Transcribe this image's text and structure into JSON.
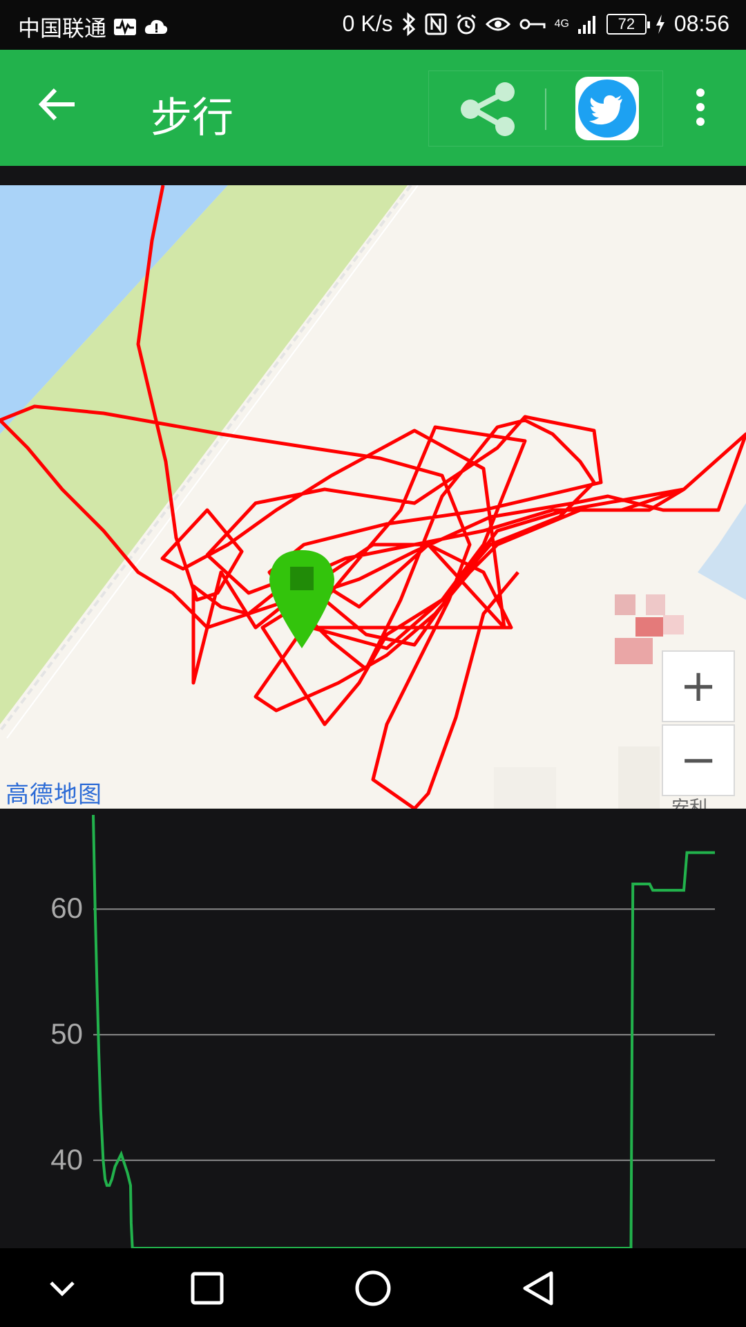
{
  "status_bar": {
    "carrier": "中国联通",
    "network_speed": "0 K/s",
    "network_type": "4G",
    "battery_level": "72",
    "time": "08:56",
    "icons": [
      "pulse-icon",
      "cloud-alert-icon",
      "bluetooth-icon",
      "nfc-icon",
      "alarm-icon",
      "eye-icon",
      "key-icon",
      "signal-icon",
      "charging-icon"
    ]
  },
  "app_bar": {
    "title": "步行",
    "icons": [
      "back-arrow-icon",
      "share-icon",
      "twitter-icon",
      "more-vert-icon"
    ],
    "color": "#22b24c"
  },
  "map": {
    "provider_logo": "高德地图",
    "zoom_in_label": "+",
    "zoom_out_label": "−",
    "poi_label_partial": "安利",
    "track_color": "#ff0000",
    "marker_color": "#33c40c"
  },
  "chart_data": {
    "type": "line",
    "title": "",
    "xlabel": "",
    "ylabel": "",
    "ylim": [
      33,
      68
    ],
    "xlim": [
      0,
      100
    ],
    "yticks": [
      60,
      50,
      40
    ],
    "grid": true,
    "line_color": "#22b24c",
    "series": [
      {
        "x": [
          0,
          0.3,
          0.6,
          0.9,
          1.2,
          1.6,
          1.9,
          2.2,
          2.6,
          3.0,
          3.5,
          4.5,
          5.5,
          6.0,
          6.1,
          6.3,
          86.5,
          86.8,
          89.5,
          90,
          95,
          95.5,
          100
        ],
        "values": [
          67.5,
          60,
          54,
          48.5,
          44,
          40,
          38.5,
          38,
          38,
          38.5,
          39.5,
          40.5,
          39,
          38,
          35,
          33,
          33,
          62,
          62,
          61.5,
          61.5,
          64.5,
          64.5
        ]
      }
    ]
  },
  "nav_bar": {
    "icons": [
      "collapse-chevron-icon",
      "recents-square-icon",
      "home-circle-icon",
      "back-triangle-icon"
    ]
  }
}
